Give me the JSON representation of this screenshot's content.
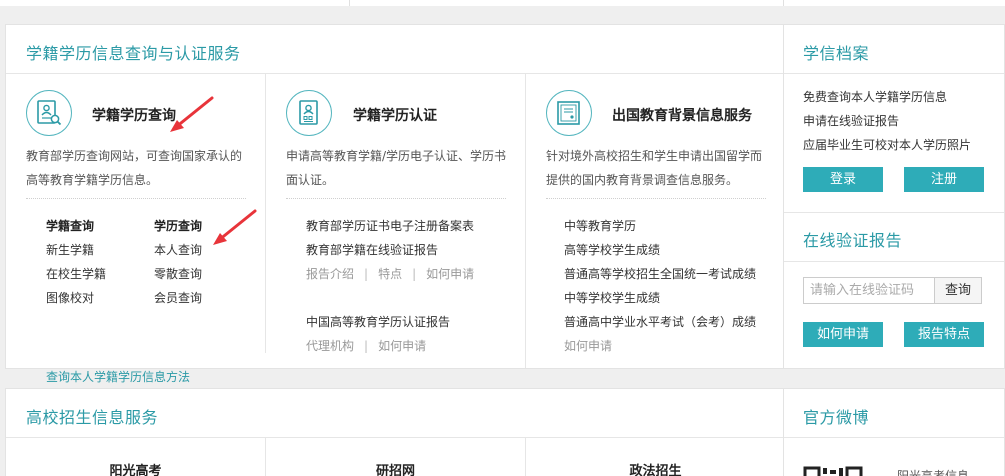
{
  "main_section": {
    "title": "学籍学历信息查询与认证服务",
    "services": [
      {
        "name": "学籍学历查询",
        "icon": "student-id-search-icon",
        "desc": "教育部学历查询网站，可查询国家承认的高等教育学籍学历信息。",
        "grid": {
          "col1_head": "学籍查询",
          "col2_head": "学历查询",
          "col1": [
            "新生学籍",
            "在校生学籍",
            "图像校对"
          ],
          "col2": [
            "本人查询",
            "零散查询",
            "会员查询"
          ]
        },
        "bottom_link": "查询本人学籍学历信息方法"
      },
      {
        "name": "学籍学历认证",
        "icon": "certificate-doc-icon",
        "desc": "申请高等教育学籍/学历电子认证、学历书面认证。",
        "links_a": [
          "教育部学历证书电子注册备案表",
          "教育部学籍在线验证报告"
        ],
        "sub_a": [
          "报告介绍",
          "特点",
          "如何申请"
        ],
        "links_b": [
          "中国高等教育学历认证报告"
        ],
        "sub_b": [
          "代理机构",
          "如何申请"
        ]
      },
      {
        "name": "出国教育背景信息服务",
        "icon": "diploma-frame-icon",
        "desc": "针对境外高校招生和学生申请出国留学而提供的国内教育背景调查信息服务。",
        "links": [
          "中等教育学历",
          "高等学校学生成绩",
          "普通高等学校招生全国统一考试成绩",
          "中等学校学生成绩",
          "普通高中学业水平考试（会考）成绩"
        ],
        "last": "如何申请"
      }
    ]
  },
  "dossier": {
    "title": "学信档案",
    "lines": [
      "免费查询本人学籍学历信息",
      "申请在线验证报告",
      "应届毕业生可校对本人学历照片"
    ],
    "login": "登录",
    "register": "注册"
  },
  "verify": {
    "title": "在线验证报告",
    "placeholder": "请输入在线验证码",
    "query": "查询",
    "how": "如何申请",
    "features": "报告特点"
  },
  "admissions": {
    "title": "高校招生信息服务",
    "items": [
      "阳光高考",
      "研招网",
      "政法招生"
    ]
  },
  "weibo": {
    "title": "官方微博",
    "text": "阳光高考信息"
  },
  "colors": {
    "accent": "#2b9aa6",
    "button": "#2eacb8",
    "arrow": "#e8343a"
  }
}
